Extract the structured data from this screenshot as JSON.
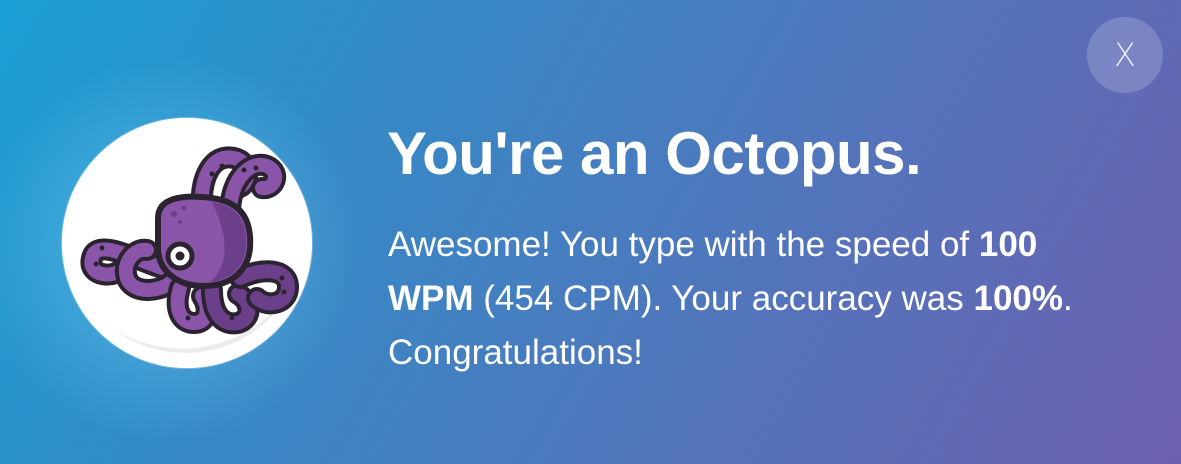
{
  "dialog": {
    "close_label": "X",
    "title": "You're an Octopus.",
    "message": {
      "part1": "Awesome! You type with the speed of ",
      "wpm": "100 WPM",
      "part2": " (454 CPM). Your accuracy was ",
      "accuracy": "100%",
      "part3": ". Congratulations!"
    },
    "avatar_icon": "octopus-icon"
  },
  "colors": {
    "gradient_start": "#1a9fd4",
    "gradient_end": "#6d5fb0",
    "octopus_body": "#8a55a8",
    "octopus_dark": "#6b3f8a",
    "outline": "#2b2430"
  }
}
